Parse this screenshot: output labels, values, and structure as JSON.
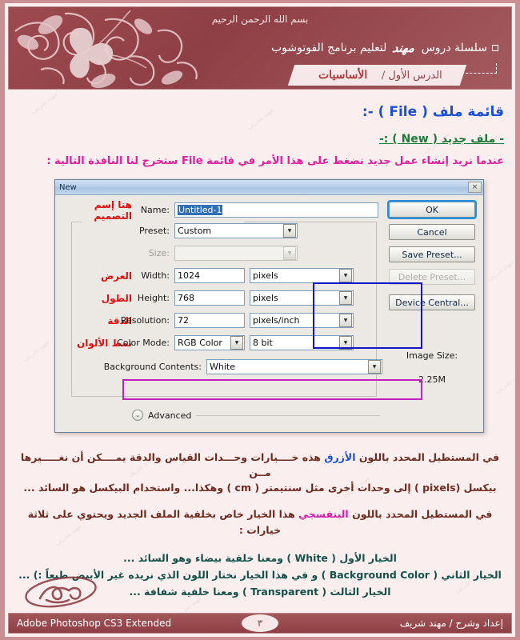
{
  "header": {
    "basmala": "بسم الله الرحمن الرحيم",
    "series_prefix": "سلسلة دروس",
    "series_signature": "مهند",
    "series_suffix": "لتعليم برنامج الفوتوشوب",
    "lesson_number": "الدرس الأول /",
    "lesson_name": "الأساسيات"
  },
  "content": {
    "file_menu_title": "قائمة ملف ( File ) -:",
    "new_file_heading": "- ملف جديد ( New ) :-",
    "intro_line": "عندما نريد إنشاء عمل جديد نضغط على هذا الأمر في قائمة File ستخرج لنا النافذة التالية  :"
  },
  "dialog": {
    "title": "New",
    "close_icon": "×",
    "name_label": "Name:",
    "name_value": "Untitled-1",
    "name_note": "هنا إسم التصميم",
    "preset_label": "Preset:",
    "preset_value": "Custom",
    "size_label": "Size:",
    "size_value": "",
    "width_label": "Width:",
    "width_value": "1024",
    "width_unit": "pixels",
    "width_note": "العرض",
    "height_label": "Height:",
    "height_value": "768",
    "height_unit": "pixels",
    "height_note": "الطول",
    "resolution_label": "Resolution:",
    "resolution_value": "72",
    "resolution_unit": "pixels/inch",
    "resolution_note": "الدقة",
    "color_mode_label": "Color Mode:",
    "color_mode_value": "RGB Color",
    "color_depth_value": "8 bit",
    "color_mode_note": "نمط الألوان",
    "background_label": "Background Contents:",
    "background_value": "White",
    "advanced_label": "Advanced",
    "advanced_icon": "chevron-down-icon",
    "image_size_label": "Image Size:",
    "image_size_value": "2.25M",
    "buttons": {
      "ok": "OK",
      "cancel": "Cancel",
      "save_preset": "Save Preset...",
      "delete_preset": "Delete Preset...",
      "device_central": "Device Central..."
    },
    "highlight_blue": "#1414c8",
    "highlight_magenta": "#c41fc4"
  },
  "explanations": {
    "para1_a": "في المستطيل المحدد باللون",
    "para1_blue": "الأزرق",
    "para1_b": "هذه خــــيارات وحـــدات القياس والدقة يمــــكن أن نغـــــيرها مــن",
    "para1_c": "بيكسل (pixels ) إلى وحدات أخرى مثل سنتيمتر ( cm ) وهكذا... واستخدام البيكسل هو السائد ...",
    "para2_a": "في المستطيل المحدد باللون",
    "para2_magenta": "البنفسجي",
    "para2_b": "هذا الخيار خاص بخلفية الملف الجديد ويحتوي على ثلاثة خيارات  :",
    "option1": "الخيار الأول ( White ) ومعنا خلفية بيضاء وهو السائد ...",
    "option2": "الخيار الثاني ( Background Color ) و في هذا الخيار نختار اللون الذي نريده غير الأبيض طبعاً :) ...",
    "option3": "الخيار الثالث ( Transparent ) ومعنا خلفية شفافة ..."
  },
  "footer": {
    "left": "Adobe Photoshop CS3 Extended",
    "page": "٣",
    "right": "إعداد وشرح / مهند شريف"
  },
  "watermark_text": "مهند شريف"
}
